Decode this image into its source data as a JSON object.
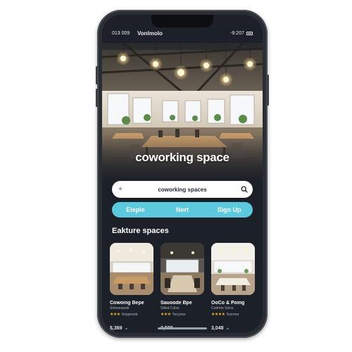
{
  "status_bar": {
    "time": "013 009",
    "carrier": "Vonlmolo",
    "right_text": "-9:207"
  },
  "hero": {
    "title": "coworking space"
  },
  "search": {
    "value": "coworking spaces",
    "leading_icon": "sparkle-icon",
    "trailing_icon": "search-icon"
  },
  "actions": [
    {
      "label": "Eleple"
    },
    {
      "label": "Nert"
    },
    {
      "label": "Sign Up"
    }
  ],
  "section": {
    "title": "Eakture spaces"
  },
  "cards": [
    {
      "name": "Cowoing Bepe",
      "sub": "Snteseasole",
      "reviews": "Srtypeoob",
      "stars": 3,
      "price": "$,369"
    },
    {
      "name": "Sauoode Bpe",
      "sub": "Silted Colse",
      "reviews": "Yeoynso",
      "stars": 3,
      "price": "2,508"
    },
    {
      "name": "OoCo & Poing",
      "sub": "Codrme Solvs",
      "reviews": "Sorrmor",
      "stars": 4,
      "price": "3,048"
    }
  ],
  "colors": {
    "accent": "#5cc9dc",
    "screen_bg": "#1b2029",
    "star": "#f2b321"
  }
}
